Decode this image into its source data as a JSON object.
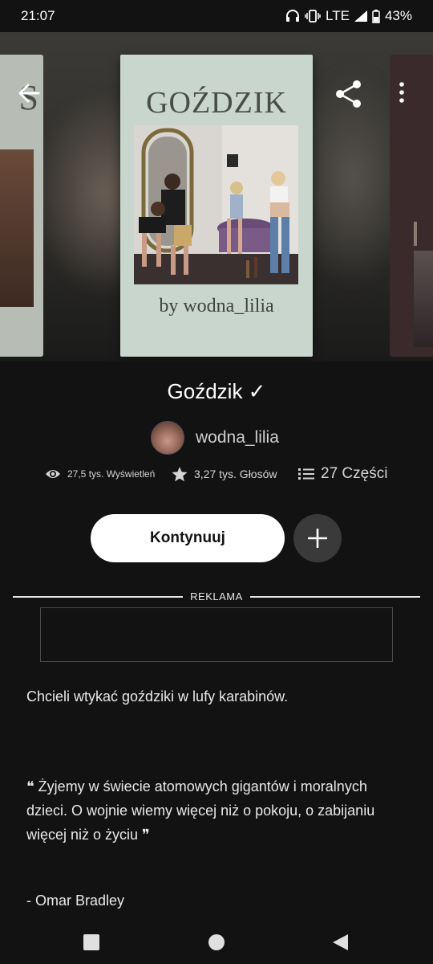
{
  "status_bar": {
    "time": "21:07",
    "network": "LTE",
    "battery": "43%",
    "icons": [
      "headphones-icon",
      "vibrate-icon",
      "signal-icon",
      "battery-icon"
    ]
  },
  "hero": {
    "cover": {
      "title": "GOŹDZIK",
      "byline": "by wodna_lilia"
    },
    "side_cover_left_letter": "S",
    "buttons": [
      "back-arrow-icon",
      "share-icon",
      "more-vert-icon"
    ]
  },
  "story": {
    "title": "Goździk ✓",
    "author": "wodna_lilia"
  },
  "stats": {
    "views": "27,5 tys. Wyświetleń",
    "votes": "3,27 tys. Głosów",
    "parts": "27 Części"
  },
  "actions": {
    "continue_label": "Kontynuuj"
  },
  "ad": {
    "label": "REKLAMA"
  },
  "description": {
    "line1": "Chcieli wtykać goździki w lufy karabinów.",
    "quote": "❝ Żyjemy w świecie atomowych gigantów i moralnych dzieci. O wojnie wiemy więcej niż o pokoju, o zabijaniu więcej niż o życiu ❞",
    "attribution": "- Omar Bradley"
  },
  "colors": {
    "background": "#121212",
    "button_primary": "#ffffff",
    "button_secondary": "#3a3a3a",
    "cover_bg": "#c8d6ce"
  }
}
